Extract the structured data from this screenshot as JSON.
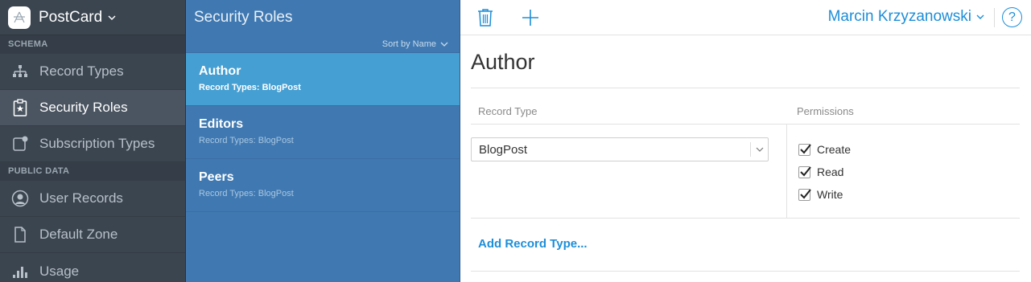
{
  "app": {
    "name": "PostCard"
  },
  "sidebar": {
    "sections": [
      {
        "title": "SCHEMA"
      },
      {
        "title": "PUBLIC DATA"
      }
    ],
    "items": [
      {
        "label": "Record Types",
        "icon": "hierarchy-icon"
      },
      {
        "label": "Security Roles",
        "icon": "badge-star-icon",
        "active": true
      },
      {
        "label": "Subscription Types",
        "icon": "subscription-icon"
      },
      {
        "label": "User Records",
        "icon": "user-icon"
      },
      {
        "label": "Default Zone",
        "icon": "document-icon"
      },
      {
        "label": "Usage",
        "icon": "bar-chart-icon"
      }
    ]
  },
  "roles_panel": {
    "title": "Security Roles",
    "sort_label": "Sort by Name",
    "roles": [
      {
        "name": "Author",
        "subtitle": "Record Types: BlogPost",
        "active": true
      },
      {
        "name": "Editors",
        "subtitle": "Record Types: BlogPost"
      },
      {
        "name": "Peers",
        "subtitle": "Record Types: BlogPost"
      }
    ]
  },
  "toolbar": {
    "delete_icon": "trash-icon",
    "add_icon": "plus-icon",
    "user_name": "Marcin Krzyzanowski",
    "help_label": "?"
  },
  "detail": {
    "title": "Author",
    "col_record_type": "Record Type",
    "col_permissions": "Permissions",
    "record_type_value": "BlogPost",
    "permissions": [
      {
        "label": "Create",
        "checked": true
      },
      {
        "label": "Read",
        "checked": true
      },
      {
        "label": "Write",
        "checked": true
      }
    ],
    "add_record_type": "Add Record Type..."
  },
  "colors": {
    "sidebar_bg": "#3b4550",
    "roles_bg": "#4079b1",
    "active_role_bg": "#459fd2",
    "accent": "#1d8ed8"
  }
}
